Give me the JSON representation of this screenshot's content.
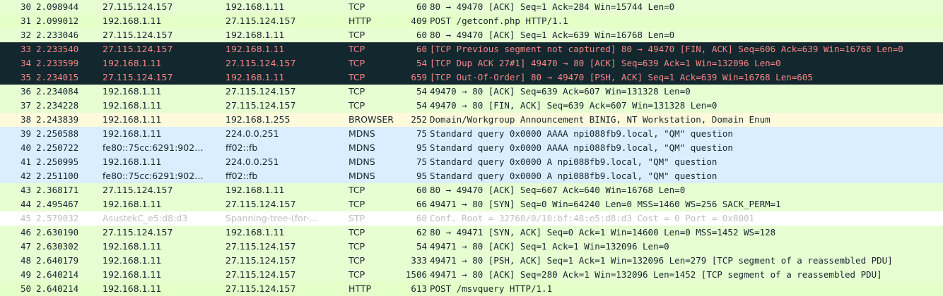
{
  "colors": {
    "tcp": {
      "bg": "#e7fdd2",
      "fg": "#12272e"
    },
    "http": {
      "bg": "#e4ffc7",
      "fg": "#12272e"
    },
    "bad_tcp": {
      "bg": "#12272e",
      "fg": "#f78787"
    },
    "browser": {
      "bg": "#fffadc",
      "fg": "#12272e"
    },
    "mdns": {
      "bg": "#daeeff",
      "fg": "#12272e"
    },
    "stp": {
      "bg": "#ffffff",
      "fg": "#bfbfbf"
    }
  },
  "packets": [
    {
      "no": "30",
      "time": "2.098944",
      "src": "27.115.124.157",
      "dst": "192.168.1.11",
      "proto": "TCP",
      "len": "60",
      "info": "80 → 49470 [ACK] Seq=1 Ack=284 Win=15744 Len=0",
      "color": "tcp"
    },
    {
      "no": "31",
      "time": "2.099012",
      "src": "192.168.1.11",
      "dst": "27.115.124.157",
      "proto": "HTTP",
      "len": "409",
      "info": "POST /getconf.php HTTP/1.1",
      "color": "http"
    },
    {
      "no": "32",
      "time": "2.233046",
      "src": "27.115.124.157",
      "dst": "192.168.1.11",
      "proto": "TCP",
      "len": "60",
      "info": "80 → 49470 [ACK] Seq=1 Ack=639 Win=16768 Len=0",
      "color": "tcp"
    },
    {
      "no": "33",
      "time": "2.233540",
      "src": "27.115.124.157",
      "dst": "192.168.1.11",
      "proto": "TCP",
      "len": "60",
      "info": "[TCP Previous segment not captured] 80 → 49470 [FIN, ACK] Seq=606 Ack=639 Win=16768 Len=0",
      "color": "bad_tcp"
    },
    {
      "no": "34",
      "time": "2.233599",
      "src": "192.168.1.11",
      "dst": "27.115.124.157",
      "proto": "TCP",
      "len": "54",
      "info": "[TCP Dup ACK 27#1] 49470 → 80 [ACK] Seq=639 Ack=1 Win=132096 Len=0",
      "color": "bad_tcp"
    },
    {
      "no": "35",
      "time": "2.234015",
      "src": "27.115.124.157",
      "dst": "192.168.1.11",
      "proto": "TCP",
      "len": "659",
      "info": "[TCP Out-Of-Order] 80 → 49470 [PSH, ACK] Seq=1 Ack=639 Win=16768 Len=605",
      "color": "bad_tcp"
    },
    {
      "no": "36",
      "time": "2.234084",
      "src": "192.168.1.11",
      "dst": "27.115.124.157",
      "proto": "TCP",
      "len": "54",
      "info": "49470 → 80 [ACK] Seq=639 Ack=607 Win=131328 Len=0",
      "color": "tcp"
    },
    {
      "no": "37",
      "time": "2.234228",
      "src": "192.168.1.11",
      "dst": "27.115.124.157",
      "proto": "TCP",
      "len": "54",
      "info": "49470 → 80 [FIN, ACK] Seq=639 Ack=607 Win=131328 Len=0",
      "color": "tcp"
    },
    {
      "no": "38",
      "time": "2.243839",
      "src": "192.168.1.11",
      "dst": "192.168.1.255",
      "proto": "BROWSER",
      "len": "252",
      "info": "Domain/Workgroup Announcement BINIG, NT Workstation, Domain Enum",
      "color": "browser"
    },
    {
      "no": "39",
      "time": "2.250588",
      "src": "192.168.1.11",
      "dst": "224.0.0.251",
      "proto": "MDNS",
      "len": "75",
      "info": "Standard query 0x0000 AAAA npi088fb9.local, \"QM\" question",
      "color": "mdns"
    },
    {
      "no": "40",
      "time": "2.250722",
      "src": "fe80::75cc:6291:902…",
      "dst": "ff02::fb",
      "proto": "MDNS",
      "len": "95",
      "info": "Standard query 0x0000 AAAA npi088fb9.local, \"QM\" question",
      "color": "mdns"
    },
    {
      "no": "41",
      "time": "2.250995",
      "src": "192.168.1.11",
      "dst": "224.0.0.251",
      "proto": "MDNS",
      "len": "75",
      "info": "Standard query 0x0000 A npi088fb9.local, \"QM\" question",
      "color": "mdns"
    },
    {
      "no": "42",
      "time": "2.251100",
      "src": "fe80::75cc:6291:902…",
      "dst": "ff02::fb",
      "proto": "MDNS",
      "len": "95",
      "info": "Standard query 0x0000 A npi088fb9.local, \"QM\" question",
      "color": "mdns"
    },
    {
      "no": "43",
      "time": "2.368171",
      "src": "27.115.124.157",
      "dst": "192.168.1.11",
      "proto": "TCP",
      "len": "60",
      "info": "80 → 49470 [ACK] Seq=607 Ack=640 Win=16768 Len=0",
      "color": "tcp"
    },
    {
      "no": "44",
      "time": "2.495467",
      "src": "192.168.1.11",
      "dst": "27.115.124.157",
      "proto": "TCP",
      "len": "66",
      "info": "49471 → 80 [SYN] Seq=0 Win=64240 Len=0 MSS=1460 WS=256 SACK_PERM=1",
      "color": "tcp"
    },
    {
      "no": "45",
      "time": "2.579032",
      "src": "AsustekC_e5:d8:d3",
      "dst": "Spanning-tree-(for-…",
      "proto": "STP",
      "len": "60",
      "info": "Conf. Root = 32768/0/10:bf:48:e5:d8:d3  Cost = 0  Port = 0x8001",
      "color": "stp"
    },
    {
      "no": "46",
      "time": "2.630190",
      "src": "27.115.124.157",
      "dst": "192.168.1.11",
      "proto": "TCP",
      "len": "62",
      "info": "80 → 49471 [SYN, ACK] Seq=0 Ack=1 Win=14600 Len=0 MSS=1452 WS=128",
      "color": "tcp"
    },
    {
      "no": "47",
      "time": "2.630302",
      "src": "192.168.1.11",
      "dst": "27.115.124.157",
      "proto": "TCP",
      "len": "54",
      "info": "49471 → 80 [ACK] Seq=1 Ack=1 Win=132096 Len=0",
      "color": "tcp"
    },
    {
      "no": "48",
      "time": "2.640179",
      "src": "192.168.1.11",
      "dst": "27.115.124.157",
      "proto": "TCP",
      "len": "333",
      "info": "49471 → 80 [PSH, ACK] Seq=1 Ack=1 Win=132096 Len=279 [TCP segment of a reassembled PDU]",
      "color": "tcp"
    },
    {
      "no": "49",
      "time": "2.640214",
      "src": "192.168.1.11",
      "dst": "27.115.124.157",
      "proto": "TCP",
      "len": "1506",
      "info": "49471 → 80 [ACK] Seq=280 Ack=1 Win=132096 Len=1452 [TCP segment of a reassembled PDU]",
      "color": "tcp"
    },
    {
      "no": "50",
      "time": "2.640214",
      "src": "192.168.1.11",
      "dst": "27.115.124.157",
      "proto": "HTTP",
      "len": "613",
      "info": "POST /msvquery HTTP/1.1",
      "color": "http"
    }
  ]
}
